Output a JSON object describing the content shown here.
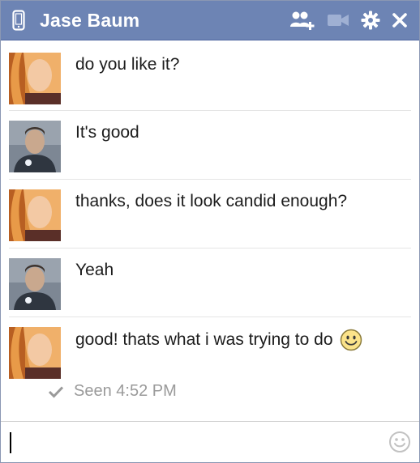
{
  "header": {
    "title": "Jase Baum",
    "icons": [
      "phone-icon",
      "add-friends-icon",
      "video-call-icon",
      "gear-icon",
      "close-icon"
    ]
  },
  "colors": {
    "titlebar": "#6d84b4",
    "titlebar_text": "#ffffff",
    "message_text": "#1c1c1c",
    "seen_text": "#9a9a9a"
  },
  "messages": [
    {
      "sender": "self",
      "text": "do you like it?"
    },
    {
      "sender": "other",
      "text": "It's good"
    },
    {
      "sender": "self",
      "text": "thanks, does it look candid enough?"
    },
    {
      "sender": "other",
      "text": "Yeah"
    },
    {
      "sender": "self",
      "text": "good! thats what i was trying to do",
      "emoji": "smiley-icon"
    }
  ],
  "status": {
    "seen_label": "Seen 4:52 PM"
  },
  "composer": {
    "value": "",
    "emoji_icon": "smiley-icon"
  }
}
